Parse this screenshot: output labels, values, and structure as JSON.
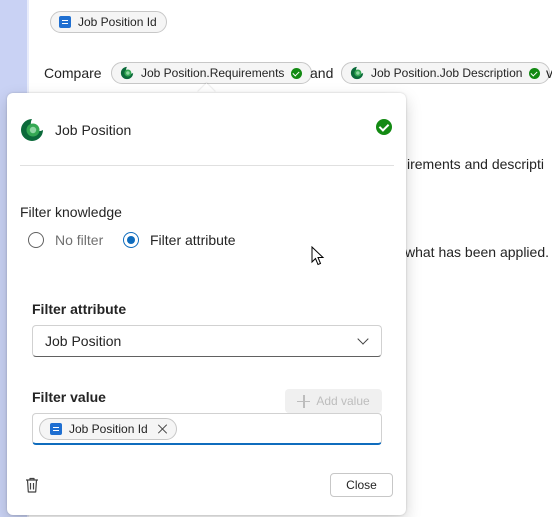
{
  "background": {
    "top_chip_label": "Job Position Id",
    "compare_text": "Compare",
    "and_text": "and",
    "chip_requirements": "Job Position.Requirements",
    "chip_description": "Job Position.Job Description",
    "cut_text_right_1": "v",
    "cut_text_line_2": "irements and descripti",
    "cut_text_line_3": "what has been applied."
  },
  "popup": {
    "title": "Job Position",
    "filter_knowledge_label": "Filter knowledge",
    "radio_no_filter": "No filter",
    "radio_filter_attribute": "Filter attribute",
    "selected_radio": "Filter attribute",
    "filter_attribute_label": "Filter attribute",
    "filter_attribute_value": "Job Position",
    "filter_value_label": "Filter value",
    "add_value_label": "Add value",
    "value_chip_label": "Job Position Id",
    "close_label": "Close"
  },
  "colors": {
    "accent": "#0f6cbd",
    "success": "#138a13",
    "doc_icon": "#1f6fd1",
    "left_strip": "#c9d2f4"
  },
  "icons": [
    "document-icon",
    "dataverse-icon",
    "check-circle-icon",
    "chevron-down-icon",
    "plus-icon",
    "dismiss-icon",
    "trash-icon",
    "mouse-cursor-icon"
  ]
}
